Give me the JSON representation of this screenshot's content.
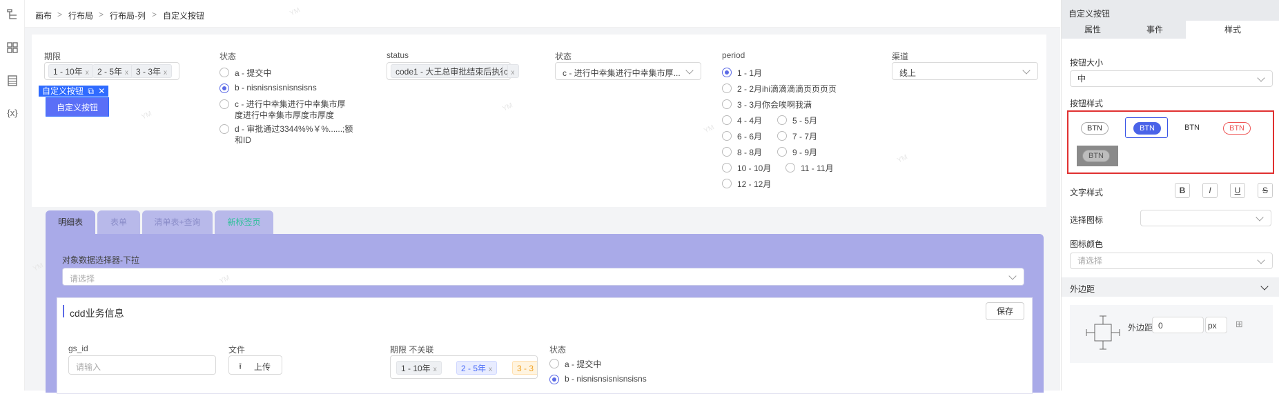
{
  "breadcrumb": [
    "画布",
    "行布局",
    "行布局-列",
    "自定义按钮"
  ],
  "breadcrumb_sep": ">",
  "form": {
    "f1": {
      "label": "期限",
      "tags": [
        "1 - 10年",
        "2 - 5年",
        "3 - 3年"
      ]
    },
    "f2": {
      "label": "状态",
      "options": [
        "a - 提交中",
        "b - nisnisnsisnisnsisns",
        "c - 进行中幸集进行中幸集市厚",
        "度进行中幸集市厚度市厚度",
        "d - 审批通过3344%%￥%......;额",
        "和ID"
      ],
      "selected": 1
    },
    "f3": {
      "label": "status",
      "tag": "code1 - 大王总审批结束后执行",
      "tag_overflow": "c"
    },
    "f4": {
      "label": "状态",
      "value": "c - 进行中幸集进行中幸集市厚..."
    },
    "f5": {
      "label": "period",
      "options": [
        "1 - 1月",
        "2 - 2月ihi滴滴滴滴页页页页",
        "3 - 3月你会唉啊我满",
        "4 - 4月",
        "5 - 5月",
        "6 - 6月",
        "7 - 7月",
        "8 - 8月",
        "9 - 9月",
        "10 - 10月",
        "11 - 11月",
        "12 - 12月"
      ]
    },
    "f6": {
      "label": "渠道",
      "value": "线上"
    }
  },
  "selected_component": {
    "tag_label": "自定义按钮",
    "button_text": "自定义按钮"
  },
  "tabs": [
    "明细表",
    "表单",
    "清单表+查询",
    "新标签页"
  ],
  "panel": {
    "picker_label": "对象数据选择器-下拉",
    "picker_placeholder": "请选择",
    "section_title": "cdd业务信息",
    "save": "保存",
    "gs_label": "gs_id",
    "gs_placeholder": "请输入",
    "file_label": "文件",
    "upload": "上传",
    "term_label": "期限 不关联",
    "term_tags": [
      "1 - 10年",
      "2 - 5年",
      "3 - 3"
    ],
    "status_label": "状态",
    "status_opts": [
      "a - 提交中",
      "b - nisnisnsisnisnsisns"
    ]
  },
  "right": {
    "title": "自定义按钮",
    "tabs": [
      "属性",
      "事件",
      "样式"
    ],
    "size_label": "按钮大小",
    "size_value": "中",
    "style_label": "按钮样式",
    "btn_text": "BTN",
    "text_style_label": "文字样式",
    "text_styles": [
      "B",
      "I",
      "U",
      "S"
    ],
    "icon_label": "选择图标",
    "icon_color_label": "图标颜色",
    "icon_color_placeholder": "请选择",
    "margin_section": "外边距",
    "margin_label": "外边距",
    "margin_value": "0",
    "margin_unit": "px"
  },
  "watermark": "YM",
  "colors": {
    "accent": "#5b6ae6",
    "highlight_border": "#e03030",
    "tab_panel": "#a9aae8"
  }
}
